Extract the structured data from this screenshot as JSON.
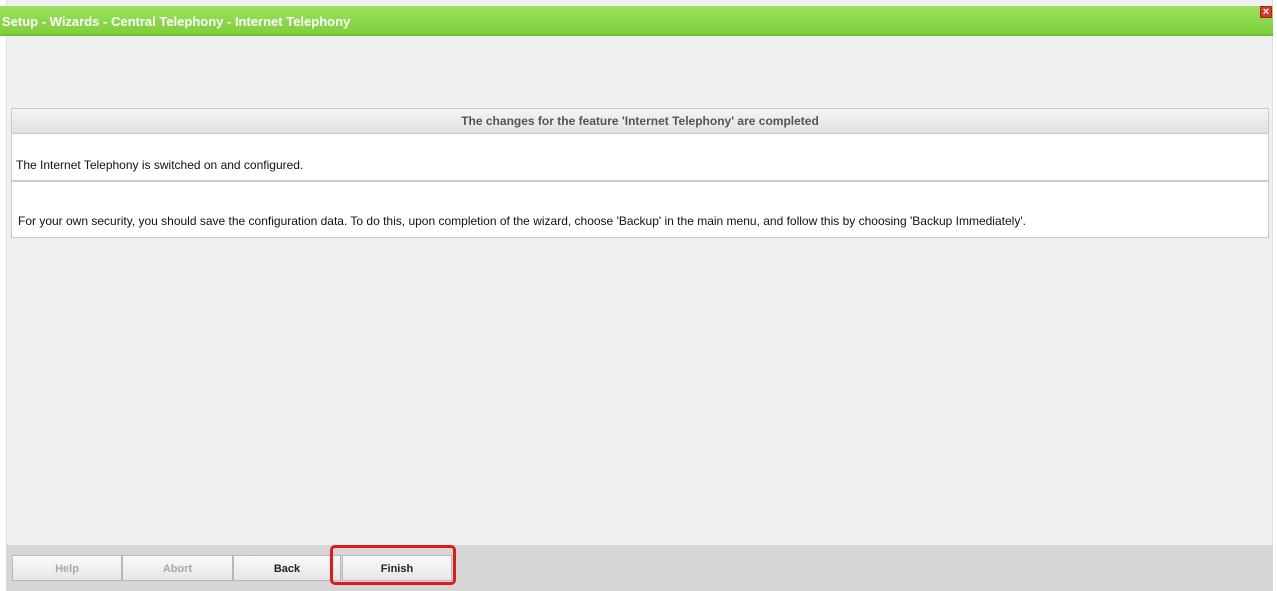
{
  "window": {
    "title": "Setup - Wizards - Central Telephony - Internet Telephony",
    "close_icon": "close-icon",
    "close_label": "×"
  },
  "panel": {
    "header": "The changes for the feature 'Internet Telephony' are completed",
    "status_text": "The Internet Telephony is switched on and configured.",
    "security_text": "For your own security, you should save the configuration data. To do this, upon completion of the wizard, choose 'Backup' in the main menu, and follow this by choosing 'Backup Immediately'."
  },
  "footer": {
    "help_label": "Help",
    "abort_label": "Abort",
    "back_label": "Back",
    "finish_label": "Finish"
  },
  "colors": {
    "titlebar": "#8bd84a",
    "highlight": "#e01a1a"
  }
}
